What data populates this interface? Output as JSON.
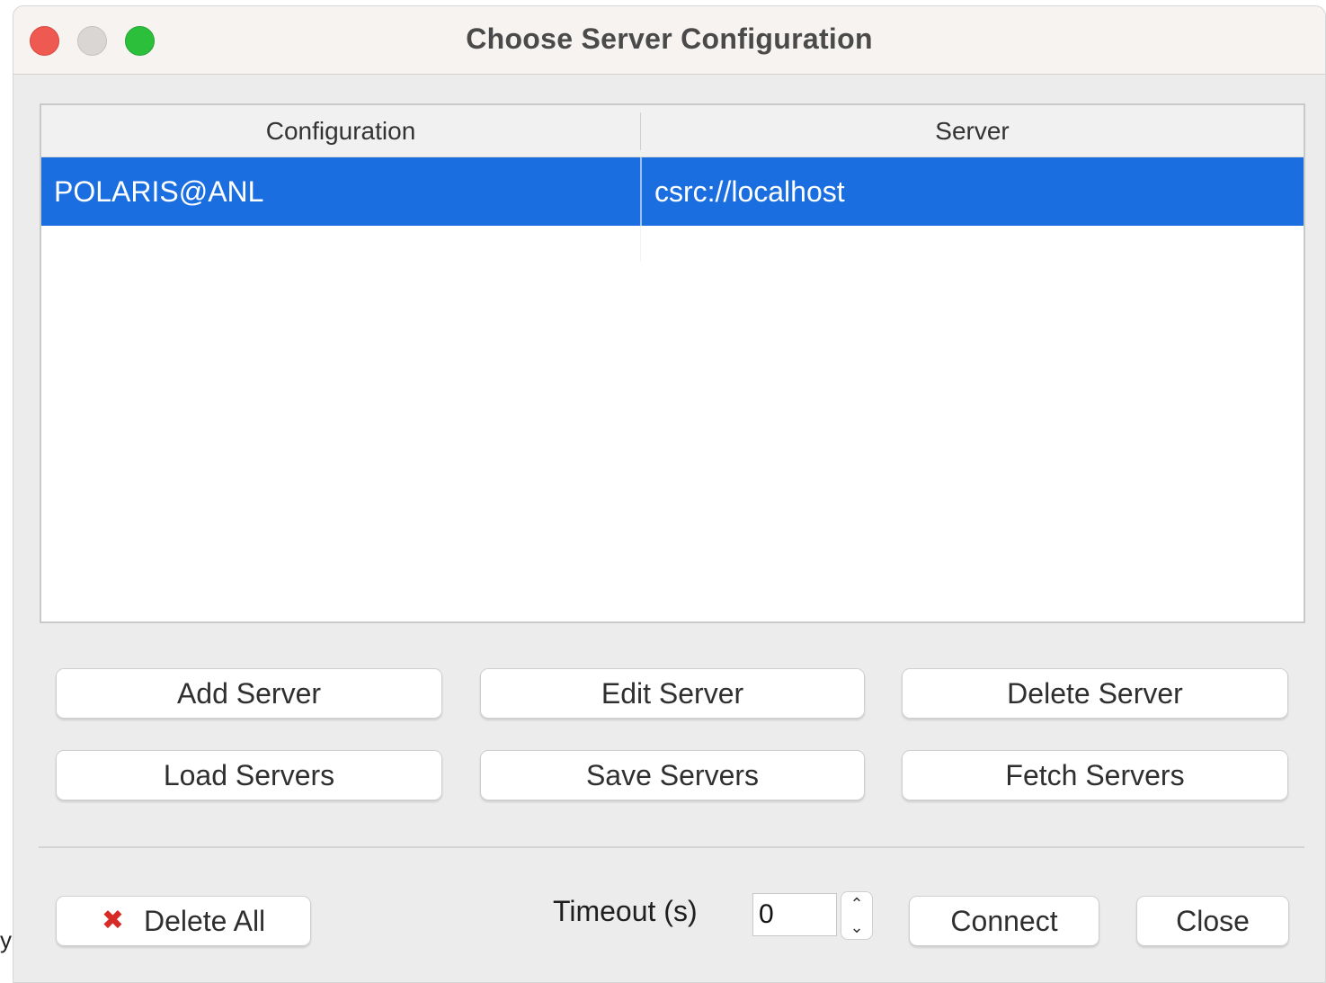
{
  "window": {
    "title": "Choose Server Configuration"
  },
  "stray_text": "y",
  "table": {
    "columns": [
      "Configuration",
      "Server"
    ],
    "rows": [
      {
        "configuration": "POLARIS@ANL",
        "server": "csrc://localhost",
        "selected": true
      }
    ]
  },
  "buttons": {
    "add_server": "Add Server",
    "edit_server": "Edit Server",
    "delete_server": "Delete Server",
    "load_servers": "Load Servers",
    "save_servers": "Save Servers",
    "fetch_servers": "Fetch Servers",
    "delete_all": "Delete All",
    "connect": "Connect",
    "close": "Close"
  },
  "timeout": {
    "label": "Timeout (s)",
    "value": "0"
  },
  "icons": {
    "delete_all": "x-mark-icon",
    "stepper": "stepper-icon"
  },
  "colors": {
    "selection": "#1a6ee0",
    "delete_icon": "#d62b27",
    "traffic_close": "#ee5a52",
    "traffic_min": "#d9d6d4",
    "traffic_max": "#2bbf3c"
  }
}
